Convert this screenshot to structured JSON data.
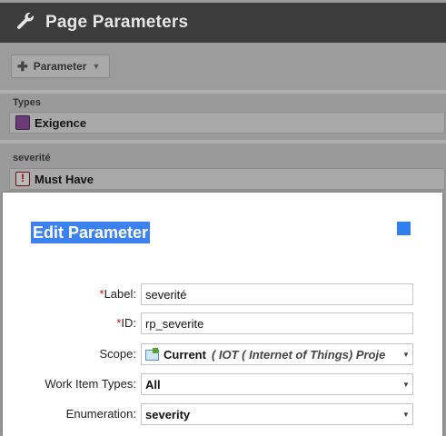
{
  "header": {
    "title": "Page Parameters",
    "icon": "wrench-icon"
  },
  "toolbar": {
    "parameter_label": "Parameter",
    "add_icon": "plus-icon"
  },
  "background_params": [
    {
      "label": "Types",
      "value": "Exigence",
      "icon": "exigence-type-icon"
    },
    {
      "label": "severité",
      "value": "Must Have",
      "icon": "must-have-icon"
    }
  ],
  "dialog": {
    "title": "Edit Parameter",
    "fields": {
      "label": {
        "name": "Label:",
        "required": "*",
        "value": "severité"
      },
      "id": {
        "name": "ID:",
        "required": "*",
        "value": "rp_severite"
      },
      "scope": {
        "name": "Scope:",
        "value": "Current",
        "detail": "( IOT ( Internet of Things) Proje"
      },
      "work_item_types": {
        "name": "Work Item Types:",
        "value": "All"
      },
      "enumeration": {
        "name": "Enumeration:",
        "value": "severity"
      }
    }
  },
  "colors": {
    "accent": "#3b82f0",
    "required": "#d01010",
    "header_bg": "#3c3c3c"
  }
}
